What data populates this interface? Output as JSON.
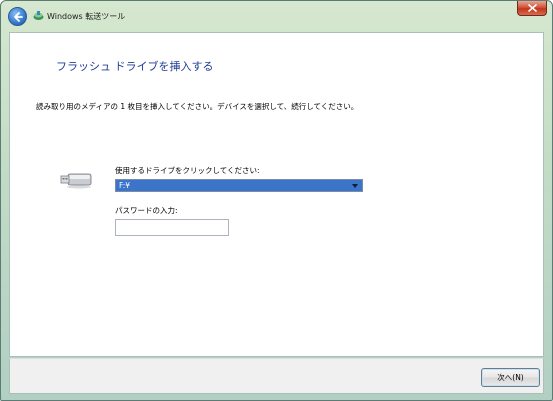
{
  "window": {
    "title": "Windows 転送ツール"
  },
  "page": {
    "title": "フラッシュ ドライブを挿入する",
    "instruction": "読み取り用のメディアの 1 枚目を挿入してください。デバイスを選択して、続行してください。"
  },
  "drive": {
    "label": "使用するドライブをクリックしてください:",
    "selected": "F:¥",
    "icon": "usb-flash-drive-icon"
  },
  "password": {
    "label": "パスワードの入力:",
    "value": ""
  },
  "footer": {
    "next_label": "次へ(N)"
  },
  "colors": {
    "title_blue": "#1f3d99",
    "select_highlight": "#3c74c9",
    "close_red": "#c23619"
  }
}
